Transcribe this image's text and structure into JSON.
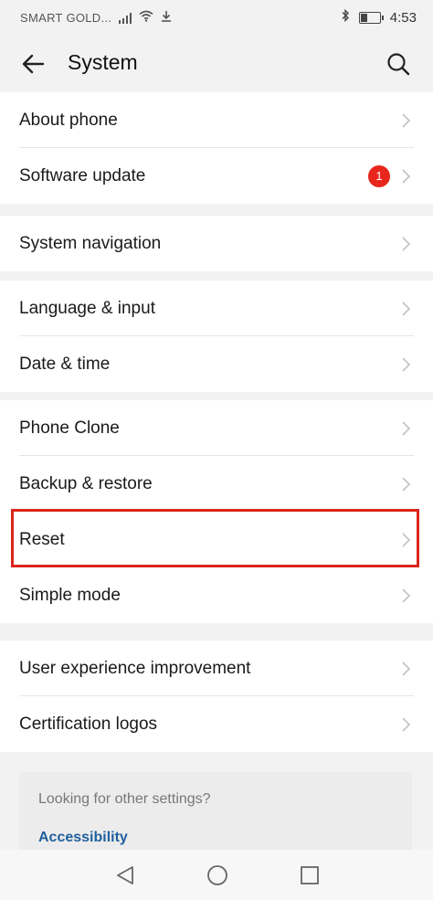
{
  "status_bar": {
    "carrier": "SMART GOLD...",
    "time": "4:53"
  },
  "header": {
    "title": "System"
  },
  "groups": [
    {
      "items": [
        {
          "label": "About phone"
        },
        {
          "label": "Software update",
          "badge": "1"
        }
      ]
    },
    {
      "items": [
        {
          "label": "System navigation"
        }
      ]
    },
    {
      "items": [
        {
          "label": "Language & input"
        },
        {
          "label": "Date & time"
        }
      ]
    },
    {
      "items": [
        {
          "label": "Phone Clone"
        },
        {
          "label": "Backup & restore"
        },
        {
          "label": "Reset"
        },
        {
          "label": "Simple mode"
        }
      ]
    },
    {
      "items": [
        {
          "label": "User experience improvement"
        },
        {
          "label": "Certification logos"
        }
      ]
    }
  ],
  "suggestion": {
    "title": "Looking for other settings?",
    "link": "Accessibility"
  },
  "colors": {
    "badge": "#e8261c",
    "highlight": "#d9261c",
    "link": "#1f5f9e"
  }
}
